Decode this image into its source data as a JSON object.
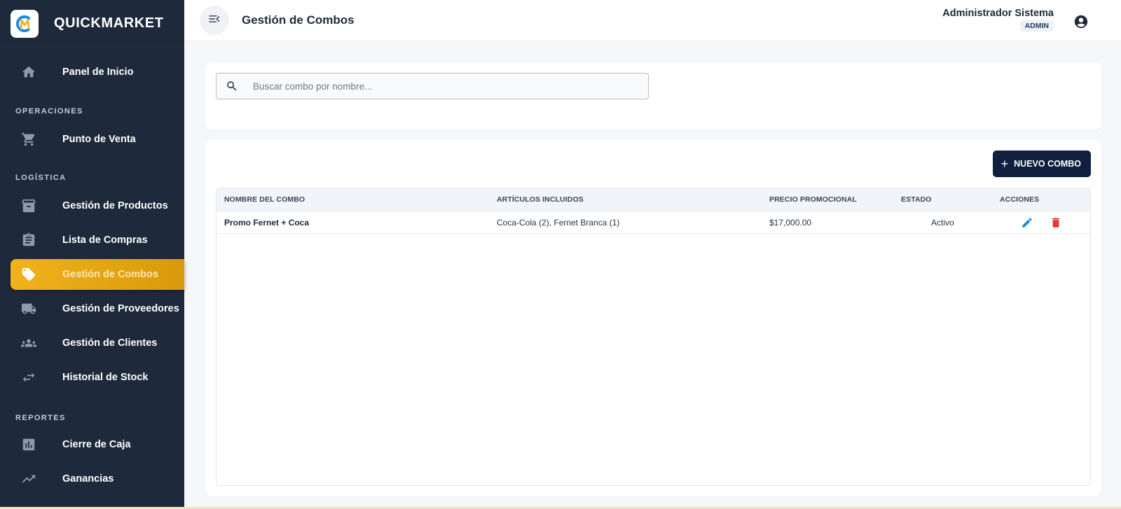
{
  "app": {
    "brand_name": "QUICKMARKET",
    "logo_letters": "QM"
  },
  "sidebar": {
    "home": {
      "label": "Panel de Inicio",
      "icon": "home-icon"
    },
    "sections": [
      {
        "title": "OPERACIONES",
        "items": [
          {
            "label": "Punto de Venta",
            "icon": "cart-icon"
          }
        ]
      },
      {
        "title": "LOGÍSTICA",
        "items": [
          {
            "label": "Gestión de Productos",
            "icon": "archive-icon"
          },
          {
            "label": "Lista de Compras",
            "icon": "clipboard-icon"
          },
          {
            "label": "Gestión de Combos",
            "icon": "tag-icon",
            "active": true
          },
          {
            "label": "Gestión de Proveedores",
            "icon": "truck-icon"
          },
          {
            "label": "Gestión de Clientes",
            "icon": "group-icon"
          },
          {
            "label": "Historial de Stock",
            "icon": "swap-arrows-icon"
          }
        ]
      },
      {
        "title": "REPORTES",
        "items": [
          {
            "label": "Cierre de Caja",
            "icon": "bar-chart-icon"
          },
          {
            "label": "Ganancias",
            "icon": "trending-up-icon"
          }
        ]
      }
    ]
  },
  "header": {
    "title": "Gestión de Combos",
    "user_name": "Administrador Sistema",
    "user_role": "ADMIN"
  },
  "search": {
    "placeholder": "Buscar combo por nombre...",
    "value": ""
  },
  "toolbar": {
    "new_label": "NUEVO COMBO"
  },
  "table": {
    "columns": [
      "NOMBRE DEL COMBO",
      "ARTÍCULOS INCLUIDOS",
      "PRECIO PROMOCIONAL",
      "ESTADO",
      "ACCIONES"
    ],
    "rows": [
      {
        "name": "Promo Fernet + Coca",
        "items": "Coca-Cola (2), Fernet Branca (1)",
        "price": "$17,000.00",
        "status": "Activo"
      }
    ]
  },
  "colors": {
    "sidebar_bg": "#1e2a3b",
    "active_accent": "#f1b21d",
    "primary_button": "#0f1f3d",
    "edit_icon": "#1e88e5",
    "delete_icon": "#e53935"
  }
}
